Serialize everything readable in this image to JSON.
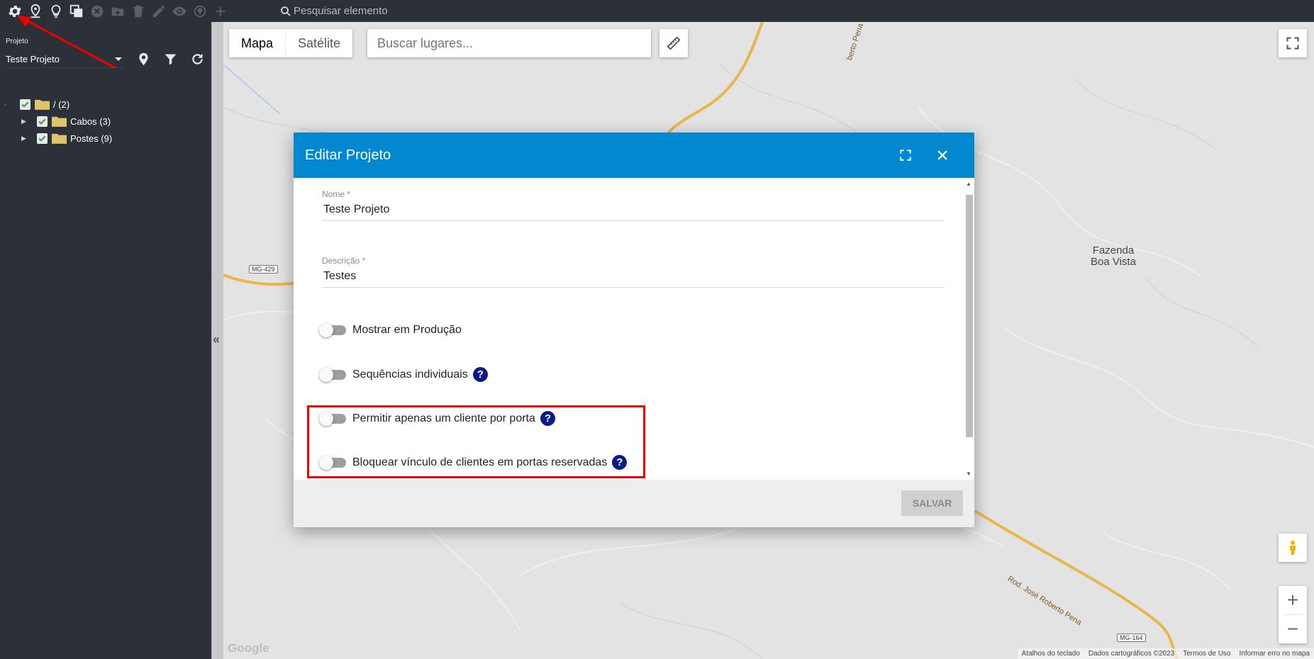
{
  "toolbar": {
    "icons": [
      "gear-icon",
      "map-pin-icon",
      "lightbulb-icon",
      "copy-icon",
      "close-circle-icon",
      "folder-plus-icon",
      "trash-icon",
      "pencil-icon",
      "eye-icon",
      "location-target-icon",
      "plus-icon"
    ],
    "search_label": "Pesquisar elemento"
  },
  "sidebar": {
    "project_label": "Projeto",
    "project_value": "Teste Projeto",
    "tree": [
      {
        "label": "/ (2)",
        "checked": true
      },
      {
        "label": "Cabos (3)",
        "checked": true
      },
      {
        "label": "Postes (9)",
        "checked": true
      }
    ]
  },
  "map": {
    "map_type_active": "Mapa",
    "map_type_other": "Satélite",
    "places_placeholder": "Buscar lugares...",
    "place_label_line1": "Fazenda",
    "place_label_line2": "Boa Vista",
    "road_shield_1": "MG-429",
    "road_shield_2": "MG-164",
    "road_name_1": "Rod. José Roberto Pena",
    "road_name_2": "berto Pena",
    "google_logo": "Google",
    "attribution": [
      "Atalhos do teclado",
      "Dados cartográficos ©2023",
      "Termos de Uso",
      "Informar erro no mapa"
    ],
    "zoom_in": "+",
    "zoom_out": "−"
  },
  "dialog": {
    "title": "Editar Projeto",
    "name_label": "Nome *",
    "name_value": "Teste Projeto",
    "description_label": "Descrição *",
    "description_value": "Testes",
    "toggles": [
      {
        "label": "Mostrar em Produção",
        "on": false,
        "help": false
      },
      {
        "label": "Sequências individuais",
        "on": false,
        "help": true
      },
      {
        "label": "Permitir apenas um cliente por porta",
        "on": false,
        "help": true
      },
      {
        "label": "Bloquear vínculo de clientes em portas reservadas",
        "on": false,
        "help": true
      }
    ],
    "help_glyph": "?",
    "save_label": "SALVAR"
  },
  "colors": {
    "dialog_header": "#0288d1",
    "sidebar_bg": "#2c3039",
    "highlight": "#e00000",
    "help_icon": "#0a1a8a"
  }
}
